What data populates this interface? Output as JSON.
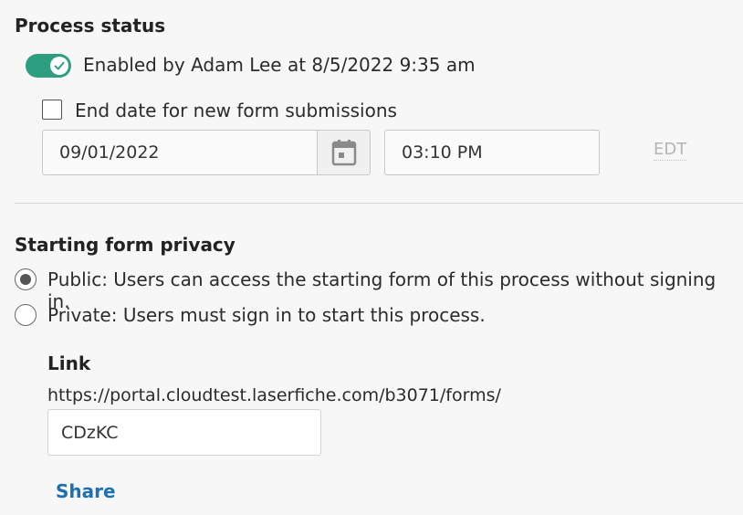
{
  "process_status": {
    "title": "Process status",
    "toggle_enabled": true,
    "enabled_text": "Enabled by Adam Lee at 8/5/2022 9:35 am",
    "end_date_checkbox_label": "End date for new form submissions",
    "end_date_checked": false,
    "date_value": "09/01/2022",
    "time_value": "03:10 PM",
    "timezone": "EDT",
    "icons": {
      "toggle": "checkmark-icon",
      "calendar": "calendar-icon"
    },
    "colors": {
      "toggle_on": "#2e9e80"
    }
  },
  "privacy": {
    "title": "Starting form privacy",
    "options": [
      {
        "label": "Public: Users can access the starting form of this process without signing in.",
        "selected": true
      },
      {
        "label": "Private: Users must sign in to start this process.",
        "selected": false
      }
    ]
  },
  "link": {
    "title": "Link",
    "url_prefix": "https://portal.cloudtest.laserfiche.com/b3071/forms/",
    "slug_value": "CDzKC",
    "share_label": "Share",
    "colors": {
      "share": "#1f6fb3"
    }
  }
}
